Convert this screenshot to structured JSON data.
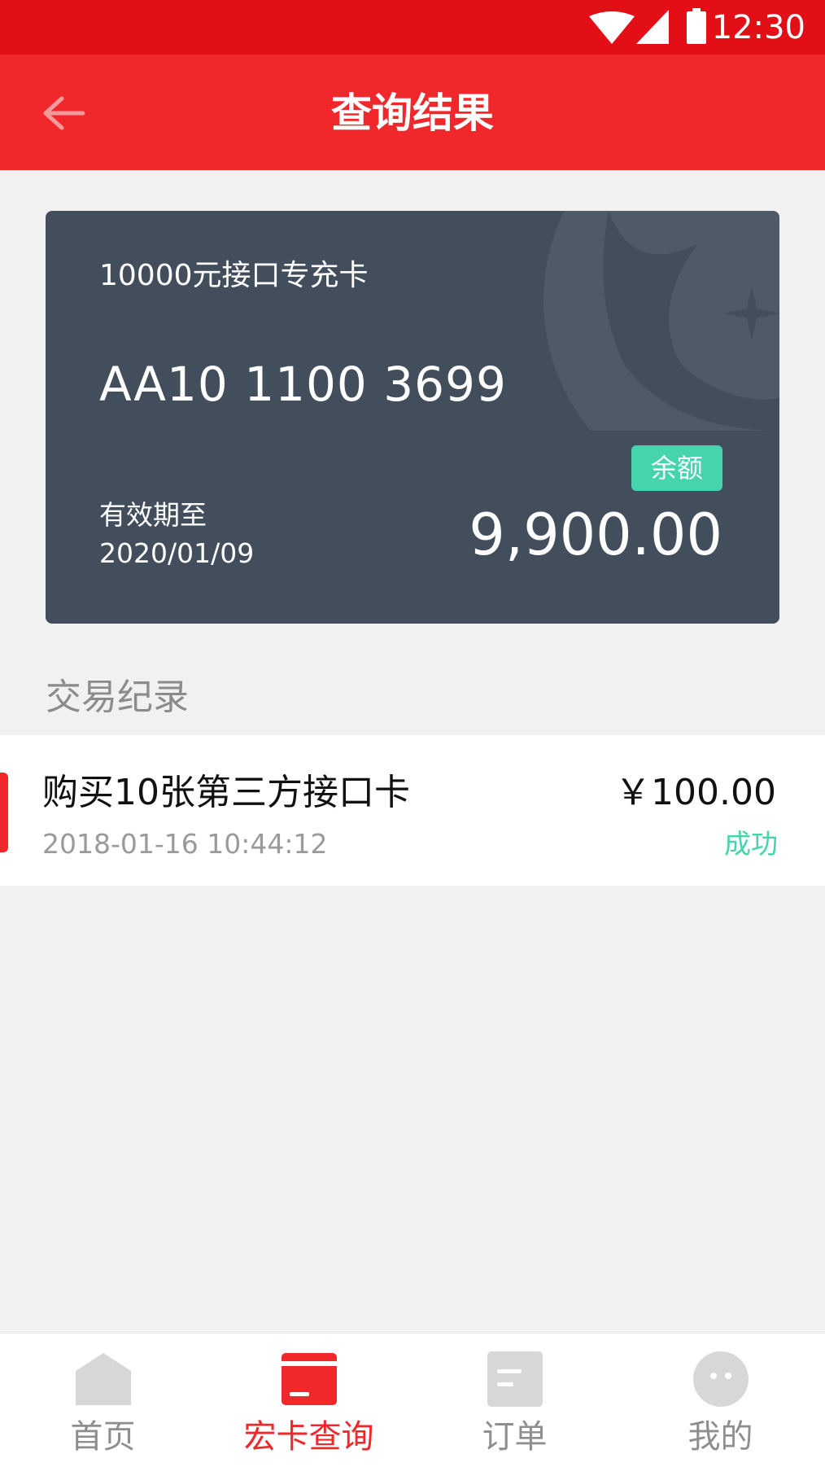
{
  "status_bar": {
    "time": "12:30",
    "icons": [
      "wifi-icon",
      "signal-icon",
      "battery-icon"
    ]
  },
  "app_bar": {
    "title": "查询结果",
    "back_icon": "arrow-left-icon"
  },
  "card": {
    "name": "10000元接口专充卡",
    "number": "AA10 1100 3699",
    "expiry_label": "有效期至",
    "expiry_date": "2020/01/09",
    "balance_label": "余额",
    "balance": "9,900.00",
    "background_color": "#434e5c",
    "badge_color": "#45d4ad"
  },
  "transactions": {
    "section_title": "交易纪录",
    "items": [
      {
        "title": "购买10张第三方接口卡",
        "time": "2018-01-16 10:44:12",
        "amount": "￥100.00",
        "status": "成功"
      }
    ]
  },
  "bottom_nav": {
    "items": [
      {
        "label": "首页",
        "icon": "home-icon",
        "active": false
      },
      {
        "label": "宏卡查询",
        "icon": "card-icon",
        "active": true
      },
      {
        "label": "订单",
        "icon": "order-icon",
        "active": false
      },
      {
        "label": "我的",
        "icon": "profile-icon",
        "active": false
      }
    ]
  },
  "colors": {
    "status_bar": "#e20f16",
    "app_bar": "#f0282c",
    "accent": "#f0282c",
    "success": "#45d4ad",
    "background": "#f1f1f1"
  }
}
